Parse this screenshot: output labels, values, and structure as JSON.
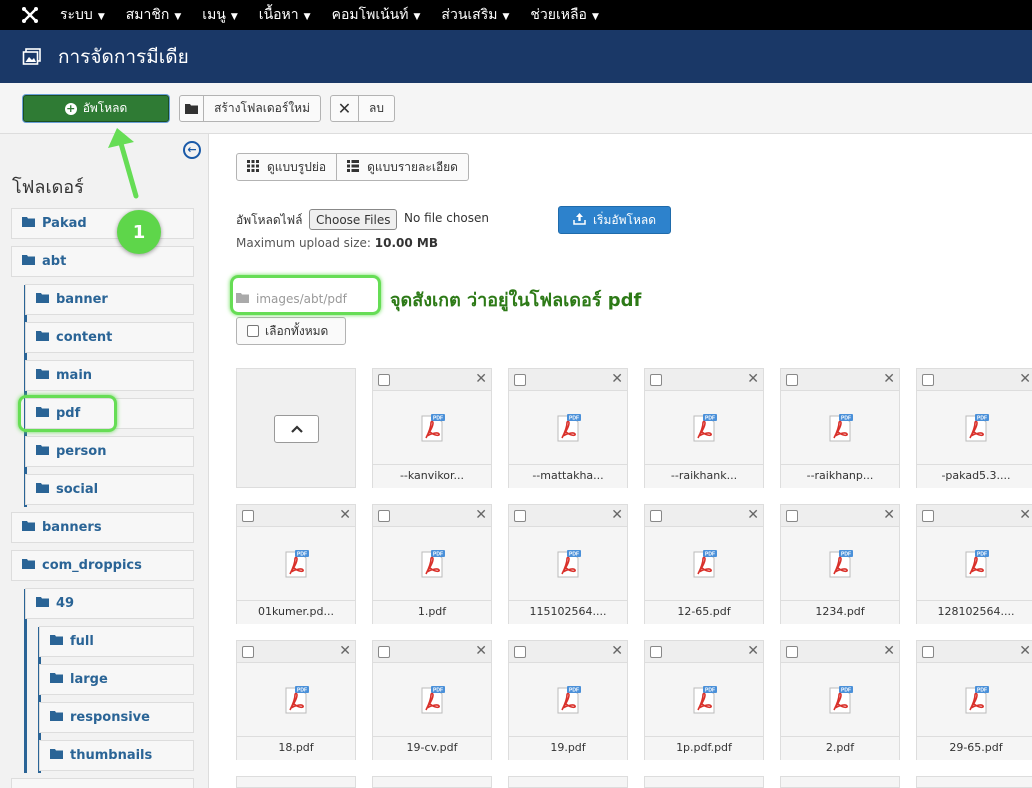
{
  "topnav": {
    "logo_icon": "joomla-logo-icon",
    "menu": [
      "ระบบ",
      "สมาชิก",
      "เมนู",
      "เนื้อหา",
      "คอมโพเน้นท์",
      "ส่วนเสริม",
      "ช่วยเหลือ"
    ]
  },
  "title": {
    "icon": "images-icon",
    "text": "การจัดการมีเดีย"
  },
  "toolbar": {
    "upload_label": "อัพโหลด",
    "new_folder_label": "สร้างโฟลเดอร์ใหม่",
    "delete_label": "ลบ"
  },
  "sidebar": {
    "heading": "โฟลเดอร์",
    "folders": [
      "Pakad",
      "abt",
      "banner",
      "content",
      "main",
      "pdf",
      "person",
      "social",
      "banners",
      "com_droppics",
      "49",
      "full",
      "large",
      "responsive",
      "thumbnails"
    ]
  },
  "view": {
    "thumbs_label": "ดูแบบรูปย่อ",
    "details_label": "ดูแบบรายละเอียด"
  },
  "upload": {
    "label": "อัพโหลดไฟล์",
    "choose_files": "Choose Files",
    "no_file": "No file chosen",
    "max_size_label": "Maximum upload size:",
    "max_size_value": "10.00 MB",
    "start_label": "เริ่มอัพโหลด"
  },
  "path": "images/abt/pdf",
  "annotation_text": "จุดสังเกต ว่าอยู่ในโฟลเดอร์ pdf",
  "annotation_badge": "1",
  "select_all_label": "เลือกทั้งหมด",
  "files": [
    "--kanvikor...",
    "--mattakha...",
    "--raikhank...",
    "--raikhanp...",
    "-pakad5.3....",
    "01kumer.pd...",
    "1.pdf",
    "115102564....",
    "12-65.pdf",
    "1234.pdf",
    "128102564....",
    "18.pdf",
    "19-cv.pdf",
    "19.pdf",
    "1p.pdf.pdf",
    "2.pdf",
    "29-65.pdf"
  ],
  "colors": {
    "accent_green": "#2f7b34",
    "header_blue": "#1a3867",
    "highlight": "#66dd55",
    "link_blue": "#2a6496"
  }
}
